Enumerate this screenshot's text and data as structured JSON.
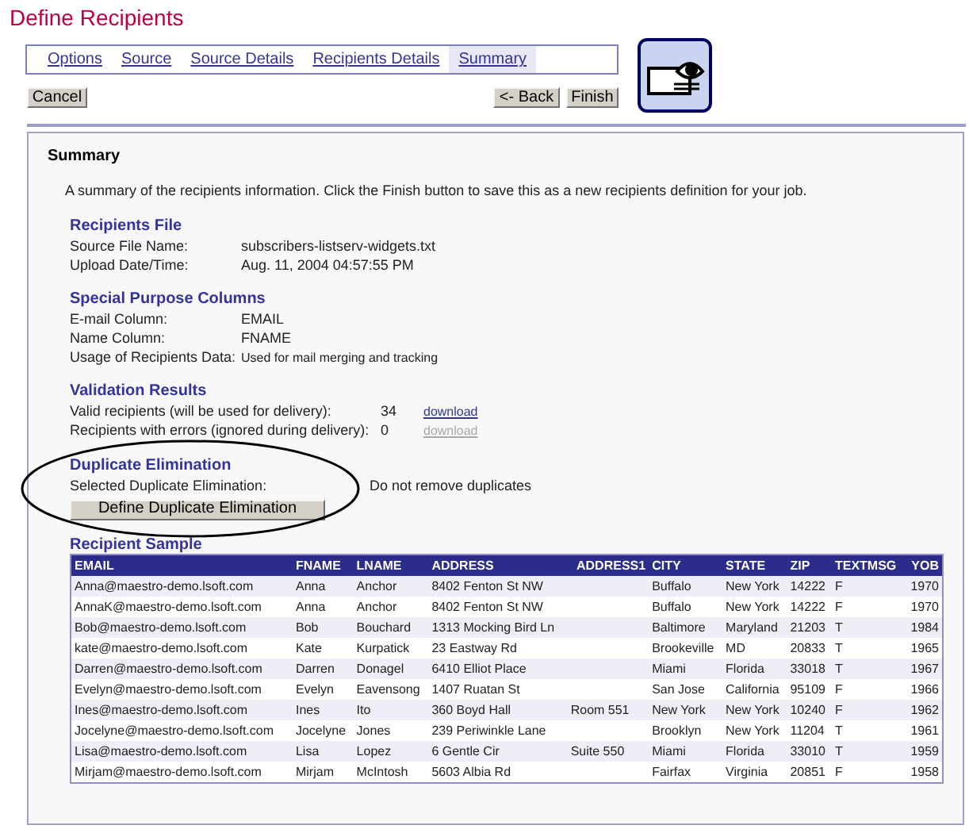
{
  "title": "Define Recipients",
  "tabs": [
    {
      "label": "Options",
      "selected": false
    },
    {
      "label": "Source",
      "selected": false
    },
    {
      "label": "Source Details",
      "selected": false
    },
    {
      "label": "Recipients Details",
      "selected": false
    },
    {
      "label": "Summary",
      "selected": true
    }
  ],
  "buttons": {
    "cancel": "Cancel",
    "back": "<- Back",
    "finish": "Finish"
  },
  "summary": {
    "heading": "Summary",
    "intro": "A summary of the recipients information. Click the Finish button to save this as a new recipients definition for your job.",
    "sections": [
      {
        "heading": "Recipients File",
        "rows": [
          {
            "label": "Source File Name:",
            "value": "subscribers-listserv-widgets.txt"
          },
          {
            "label": "Upload Date/Time:",
            "value": "Aug. 11, 2004 04:57:55 PM"
          }
        ]
      },
      {
        "heading": "Special Purpose Columns",
        "rows": [
          {
            "label": "E-mail Column:",
            "value": "EMAIL"
          },
          {
            "label": "Name Column:",
            "value": "FNAME"
          },
          {
            "label": "Usage of Recipients Data:",
            "value": "Used for mail merging and tracking",
            "small": true
          }
        ]
      }
    ],
    "validation": {
      "heading": "Validation Results",
      "rows": [
        {
          "label": "Valid recipients (will be used for delivery):",
          "value": "34",
          "link": "download",
          "disabled": false
        },
        {
          "label": "Recipients with errors (ignored during delivery):",
          "value": "0",
          "link": "download",
          "disabled": true
        }
      ]
    },
    "duplicates": {
      "heading": "Duplicate Elimination",
      "label": "Selected Duplicate Elimination:",
      "value": "Do not remove duplicates",
      "button": "Define Duplicate Elimination"
    },
    "sample": {
      "heading": "Recipient Sample",
      "columns": [
        "EMAIL",
        "FNAME",
        "LNAME",
        "ADDRESS",
        "ADDRESS1",
        "CITY",
        "STATE",
        "ZIP",
        "TEXTMSG",
        "YOB"
      ],
      "rows": [
        [
          "Anna@maestro-demo.lsoft.com",
          "Anna",
          "Anchor",
          "8402 Fenton St NW",
          "",
          "Buffalo",
          "New York",
          "14222",
          "F",
          "1970"
        ],
        [
          "AnnaK@maestro-demo.lsoft.com",
          "Anna",
          "Anchor",
          "8402 Fenton St NW",
          "",
          "Buffalo",
          "New York",
          "14222",
          "F",
          "1970"
        ],
        [
          "Bob@maestro-demo.lsoft.com",
          "Bob",
          "Bouchard",
          "1313 Mocking Bird Ln",
          "",
          "Baltimore",
          "Maryland",
          "21203",
          "T",
          "1984"
        ],
        [
          "kate@maestro-demo.lsoft.com",
          "Kate",
          "Kurpatick",
          "23 Eastway Rd",
          "",
          "Brookeville",
          "MD",
          "20833",
          "T",
          "1965"
        ],
        [
          "Darren@maestro-demo.lsoft.com",
          "Darren",
          "Donagel",
          "6410 Elliot Place",
          "",
          "Miami",
          "Florida",
          "33018",
          "T",
          "1967"
        ],
        [
          "Evelyn@maestro-demo.lsoft.com",
          "Evelyn",
          "Eavensong",
          "1407 Ruatan St",
          "",
          "San Jose",
          "California",
          "95109",
          "F",
          "1966"
        ],
        [
          "Ines@maestro-demo.lsoft.com",
          "Ines",
          "Ito",
          "360 Boyd Hall",
          "Room 551",
          "New York",
          "New York",
          "10240",
          "F",
          "1962"
        ],
        [
          "Jocelyne@maestro-demo.lsoft.com",
          "Jocelyne",
          "Jones",
          "239 Periwinkle Lane",
          "",
          "Brooklyn",
          "New York",
          "11204",
          "T",
          "1961"
        ],
        [
          "Lisa@maestro-demo.lsoft.com",
          "Lisa",
          "Lopez",
          "6 Gentle Cir",
          "Suite 550",
          "Miami",
          "Florida",
          "33010",
          "T",
          "1959"
        ],
        [
          "Mirjam@maestro-demo.lsoft.com",
          "Mirjam",
          "McIntosh",
          "5603 Albia Rd",
          "",
          "Fairfax",
          "Virginia",
          "20851",
          "F",
          "1958"
        ]
      ]
    }
  }
}
